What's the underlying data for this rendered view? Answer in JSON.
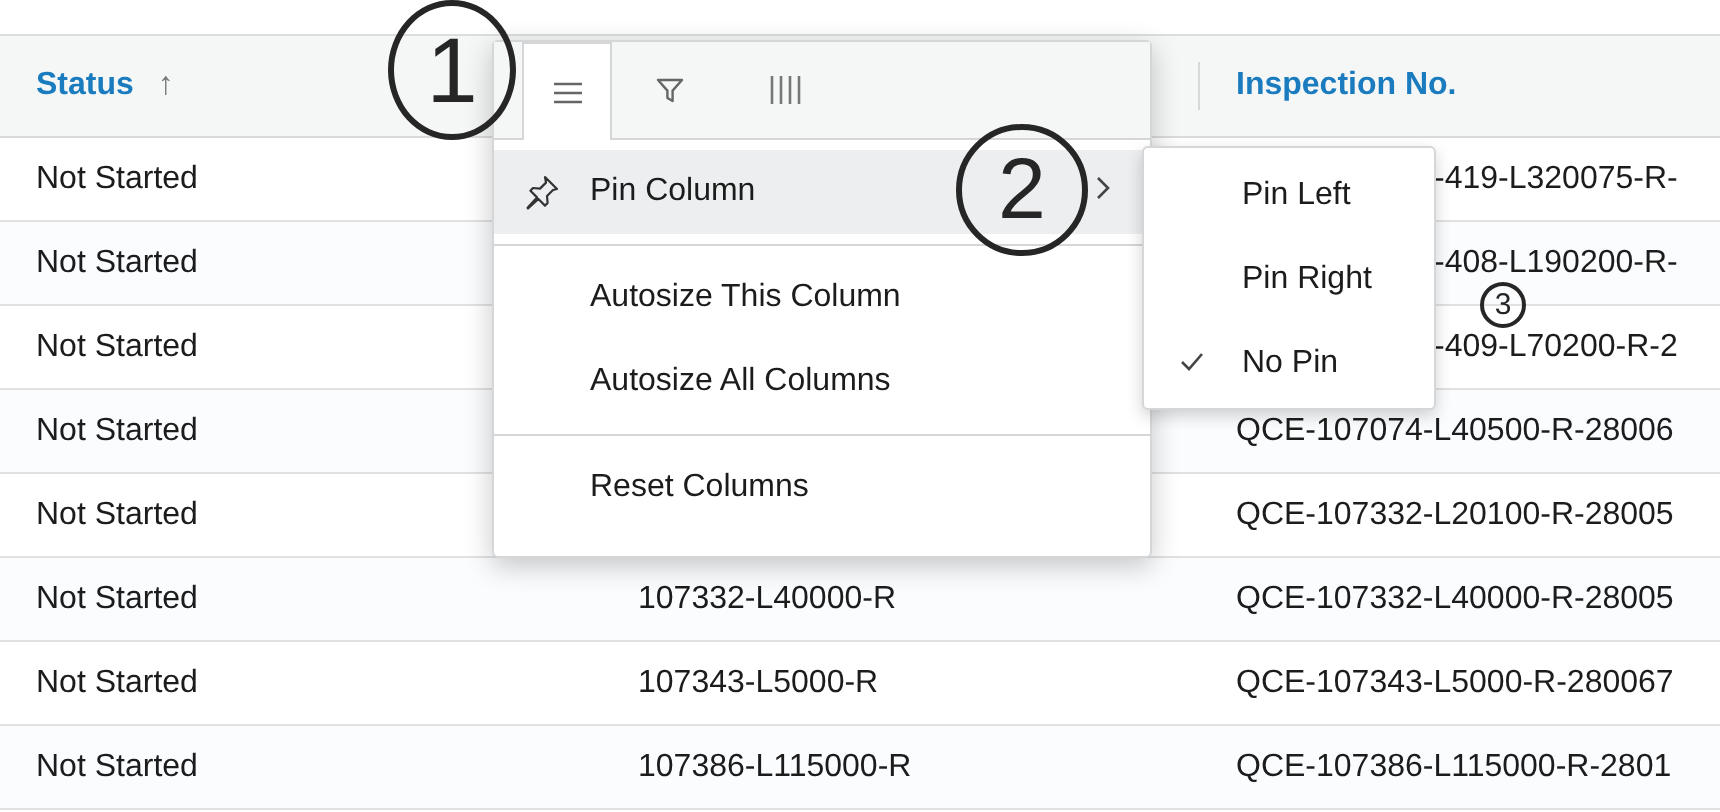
{
  "header": {
    "status_column": {
      "label": "Status",
      "sort_icon": "↑"
    },
    "column_3": {
      "label": "Inspection No."
    }
  },
  "rows": [
    {
      "status": "Not Started",
      "column_3": "-419-L320075-R-"
    },
    {
      "status": "Not Started",
      "column_3": "-408-L190200-R-"
    },
    {
      "status": "Not Started",
      "column_3": "-409-L70200-R-2"
    },
    {
      "status": "Not Started",
      "column_3": "QCE-107074-L40500-R-28006"
    },
    {
      "status": "Not Started",
      "column_3": "QCE-107332-L20100-R-28005"
    },
    {
      "status": "Not Started",
      "column_2": "107332-L40000-R",
      "column_3": "QCE-107332-L40000-R-28005"
    },
    {
      "status": "Not Started",
      "column_2": "107343-L5000-R",
      "column_3": "QCE-107343-L5000-R-280067"
    },
    {
      "status": "Not Started",
      "column_2": "107386-L115000-R",
      "column_3": "QCE-107386-L115000-R-2801"
    }
  ],
  "column_menu": {
    "tabs": [
      {
        "kind": "general",
        "selected": true
      },
      {
        "kind": "filter",
        "selected": false
      },
      {
        "kind": "columns",
        "selected": false
      }
    ],
    "groups": [
      [
        {
          "label": "Pin Column",
          "kind": "pin",
          "highlighted": true,
          "has_submenu": true
        }
      ],
      [
        {
          "label": "Autosize This Column",
          "highlighted": false,
          "has_submenu": false
        },
        {
          "label": "Autosize All Columns",
          "highlighted": false,
          "has_submenu": false
        }
      ],
      [
        {
          "label": "Reset Columns",
          "highlighted": false,
          "has_submenu": false
        }
      ]
    ],
    "submenu": [
      {
        "label": "Pin Left",
        "checked": false
      },
      {
        "label": "Pin Right",
        "checked": false
      },
      {
        "label": "No Pin",
        "checked": true
      }
    ]
  },
  "annotations": [
    {
      "label": "1"
    },
    {
      "label": "2"
    },
    {
      "label": "3"
    }
  ]
}
